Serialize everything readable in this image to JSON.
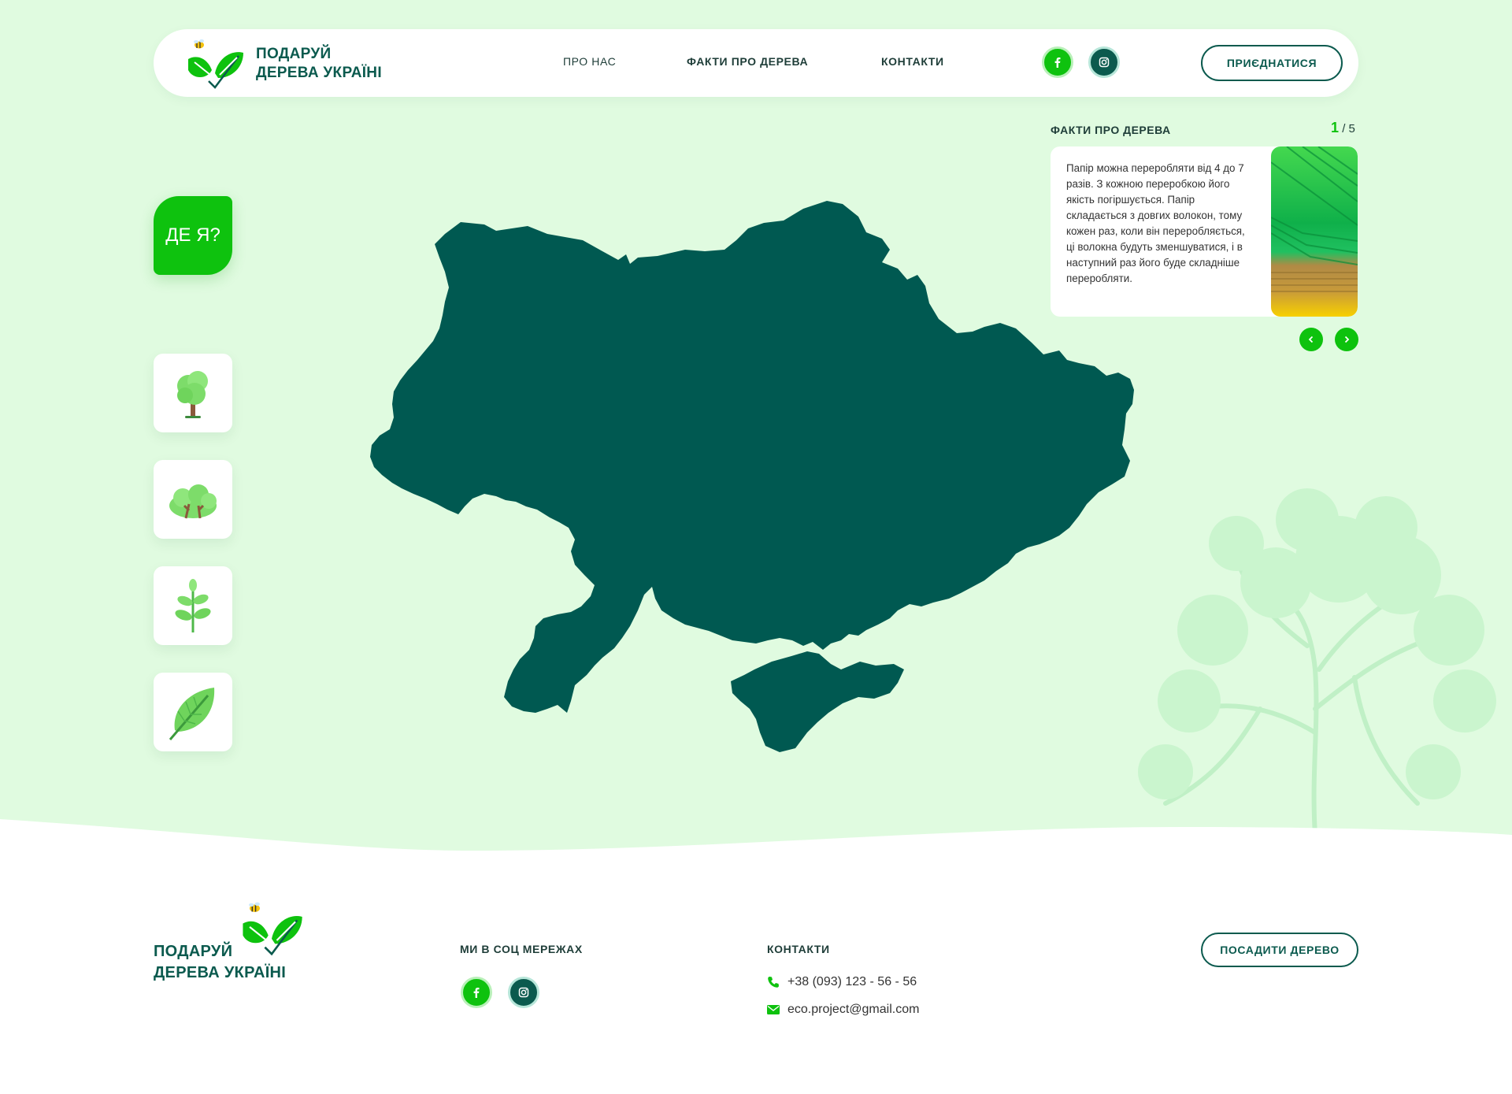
{
  "header": {
    "brand_line1": "ПОДАРУЙ",
    "brand_line2": "ДЕРЕВА УКРАЇНІ",
    "nav": [
      "ПРО НАС",
      "ФАКТИ ПРО ДЕРЕВА",
      "КОНТАКТИ"
    ],
    "join_label": "ПРИЄДНАТИСЯ",
    "social_icons": [
      "facebook-icon",
      "instagram-icon"
    ]
  },
  "sidebar": {
    "where_label": "ДЕ Я?",
    "tiles": [
      "tree-icon",
      "bush-icon",
      "sprout-icon",
      "leaf-icon"
    ]
  },
  "facts": {
    "title": "ФАКТИ ПРО ДЕРЕВА",
    "current": "1",
    "total": "/ 5",
    "text": "Папір можна переробляти від 4 до 7 разів. З кожною переробкою його якість погіршується. Папір складається з довгих волокон, тому кожен раз, коли він переробляється, ці волокна будуть зменшуватися, і в наступний раз його буде складніше переробляти."
  },
  "footer": {
    "brand_line1": "ПОДАРУЙ",
    "brand_line2": "ДЕРЕВА УКРАЇНІ",
    "social_title": "МИ В СОЦ МЕРЕЖАХ",
    "contacts_title": "КОНТАКТИ",
    "phone": "+38 (093) 123 - 56 - 56",
    "email": "eco.project@gmail.com",
    "plant_label": "ПОСАДИТИ ДЕРЕВО"
  },
  "colors": {
    "accent": "#0ec20e",
    "dark": "#0b5a4e",
    "hero_bg": "#e0fbe0"
  }
}
